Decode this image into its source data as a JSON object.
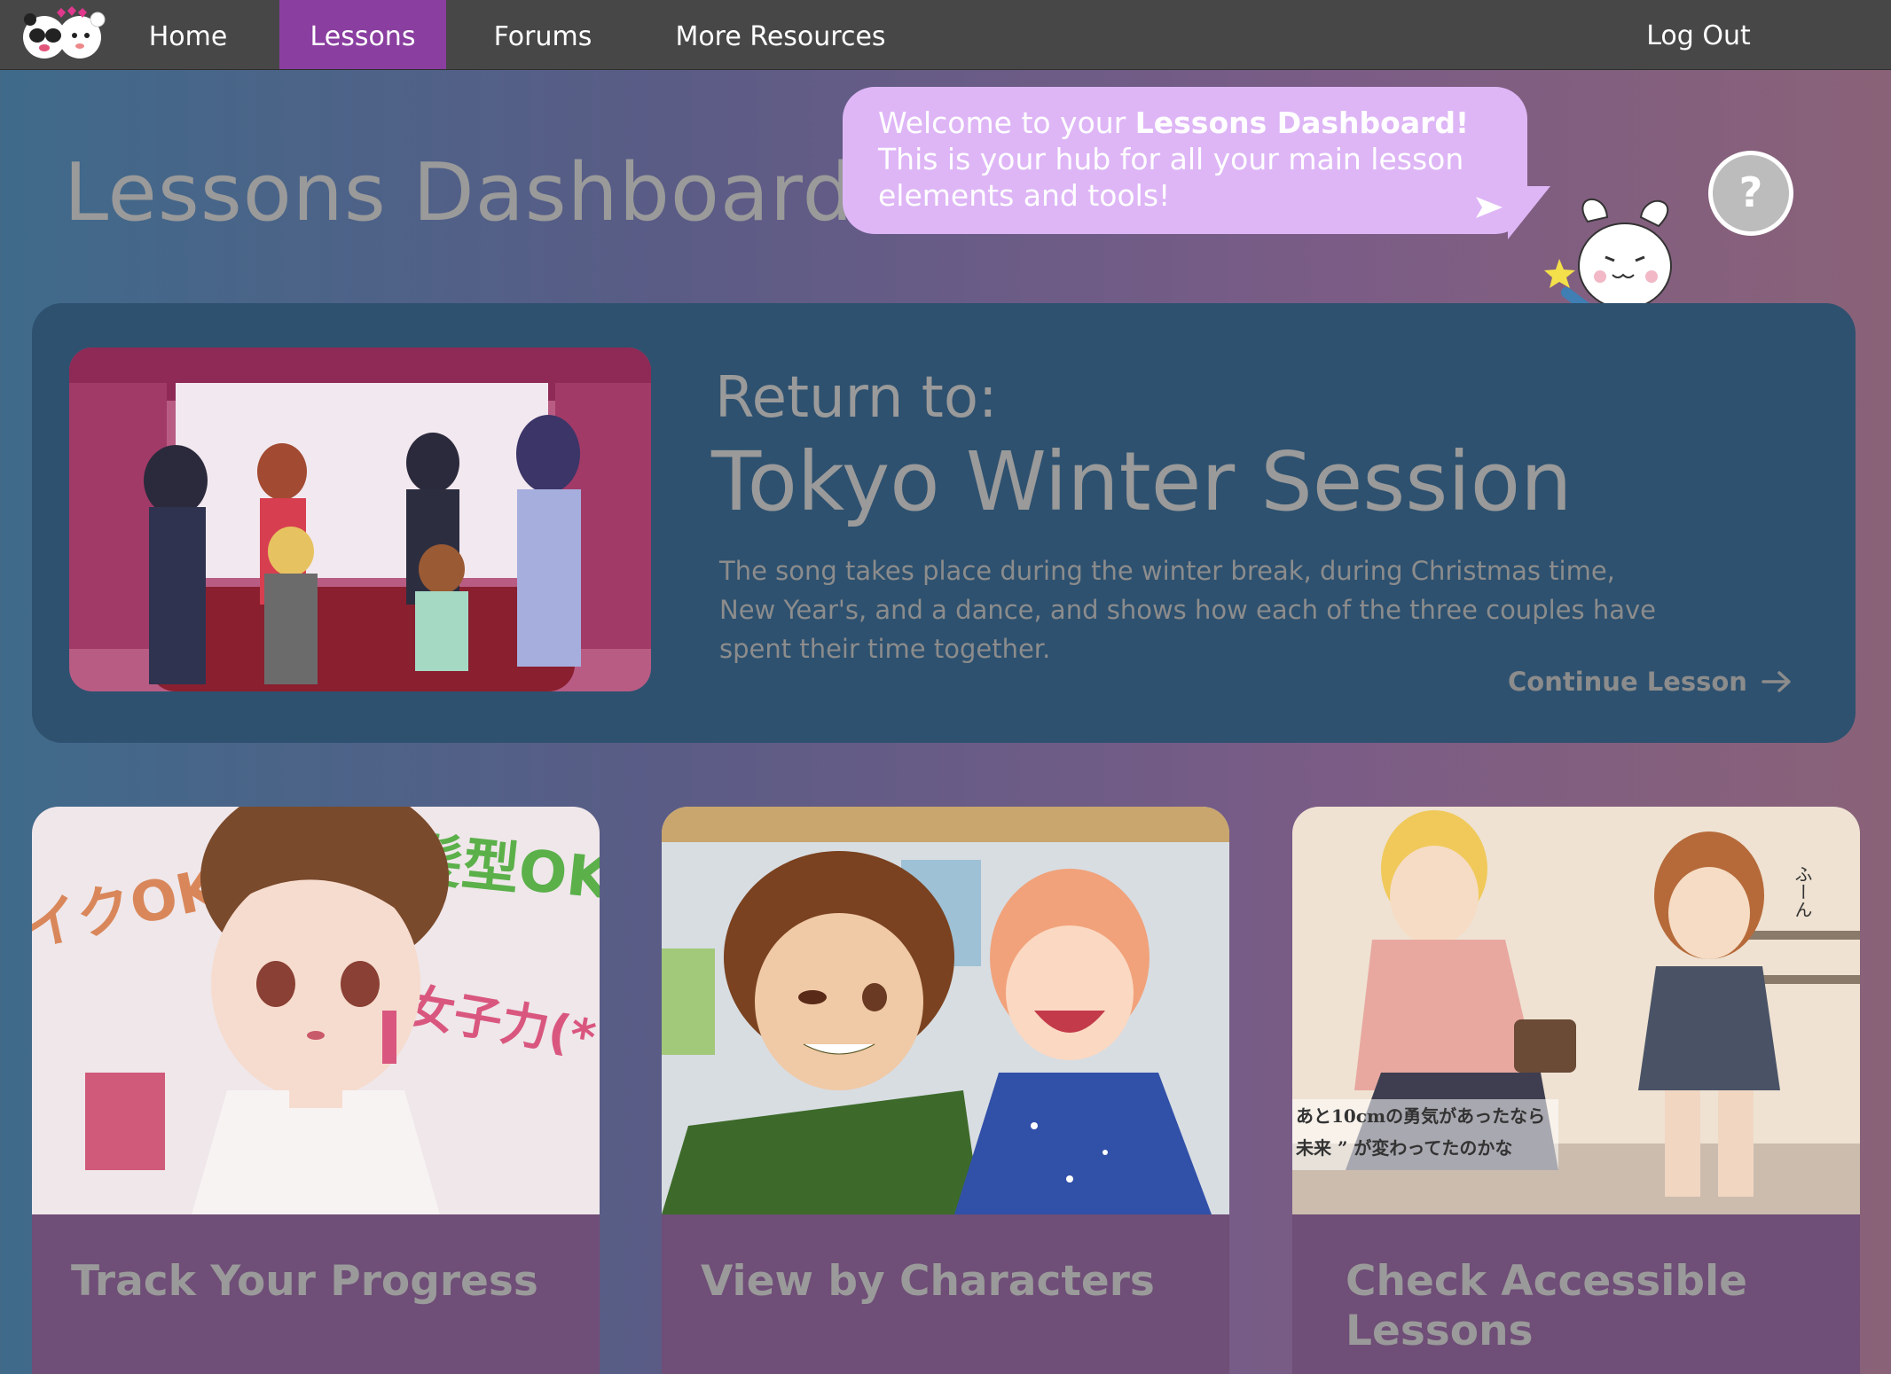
{
  "nav": {
    "items": [
      {
        "label": "Home"
      },
      {
        "label": "Lessons",
        "active": true
      },
      {
        "label": "Forums"
      },
      {
        "label": "More Resources"
      }
    ],
    "logout_label": "Log Out",
    "active_color": "#8a3ea0"
  },
  "page": {
    "title": "Lessons Dashboard"
  },
  "guide": {
    "line1_prefix": "Welcome to your ",
    "line1_bold": "Lessons Dashboard!",
    "line2": "This is your hub for all your main lesson",
    "line3": "elements and tools!",
    "help_label": "?",
    "help_icon": "question-icon",
    "sound_icon": "speaker-icon",
    "bubble_color": "#deb6f6"
  },
  "resume": {
    "subtitle": "Return to:",
    "title": "Tokyo Winter Session",
    "description": "The song takes place during the winter break, during Christmas time, New Year's, and a dance, and shows how each of the three couples have spent their time together.",
    "continue_label": "Continue Lesson",
    "continue_icon": "arrow-right-icon"
  },
  "cards": [
    {
      "title": "Track Your Progress"
    },
    {
      "title": "View by Characters"
    },
    {
      "title": "Check Accessible Lessons"
    }
  ],
  "card_image_text": {
    "card1": [
      "イクOK!",
      "髪型OK",
      "女子力(*ˇ∀"
    ],
    "card3": [
      "ふーん",
      "あと10cmの勇気があったなら",
      "未来 ” が変わってたのかな"
    ]
  }
}
